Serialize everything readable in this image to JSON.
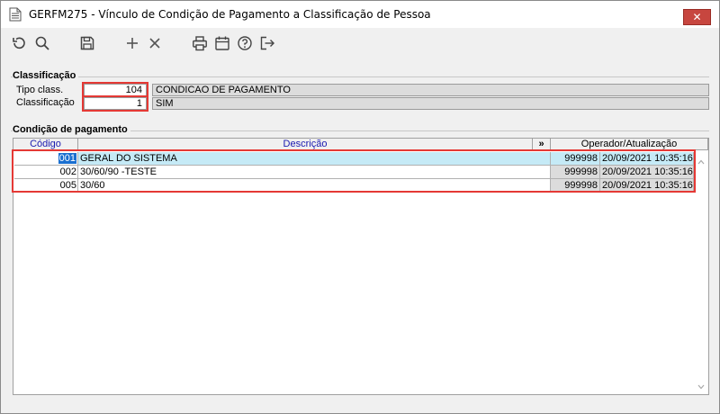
{
  "window": {
    "title": "GERFM275 - Vínculo de Condição de Pagamento a Classificação de Pessoa",
    "close_label": "✕"
  },
  "toolbar": {
    "icons": [
      "refresh-icon",
      "search-icon",
      "save-icon",
      "add-icon",
      "delete-icon",
      "print-icon",
      "calendar-icon",
      "help-icon",
      "exit-icon"
    ]
  },
  "classificacao": {
    "group_label": "Classificação",
    "tipo_label": "Tipo class.",
    "tipo_value": "104",
    "tipo_desc": "CONDICAO DE PAGAMENTO",
    "class_label": "Classificação",
    "class_value": "1",
    "class_desc": "SIM"
  },
  "condicao": {
    "group_label": "Condição de pagamento",
    "columns": {
      "code": "Código",
      "desc": "Descrição",
      "expand": "»",
      "operator": "Operador/Atualização"
    },
    "rows": [
      {
        "code": "001",
        "desc": "GERAL DO SISTEMA",
        "operator": "999998",
        "datetime": "20/09/2021 10:35:16"
      },
      {
        "code": "002",
        "desc": "30/60/90 -TESTE",
        "operator": "999998",
        "datetime": "20/09/2021 10:35:16"
      },
      {
        "code": "005",
        "desc": "30/60",
        "operator": "999998",
        "datetime": "20/09/2021 10:35:16"
      }
    ]
  },
  "colors": {
    "highlight_outline": "#e53935",
    "selected_row": "#c5eaf6",
    "selected_code": "#1a6fd0",
    "close_button": "#c7463f"
  }
}
